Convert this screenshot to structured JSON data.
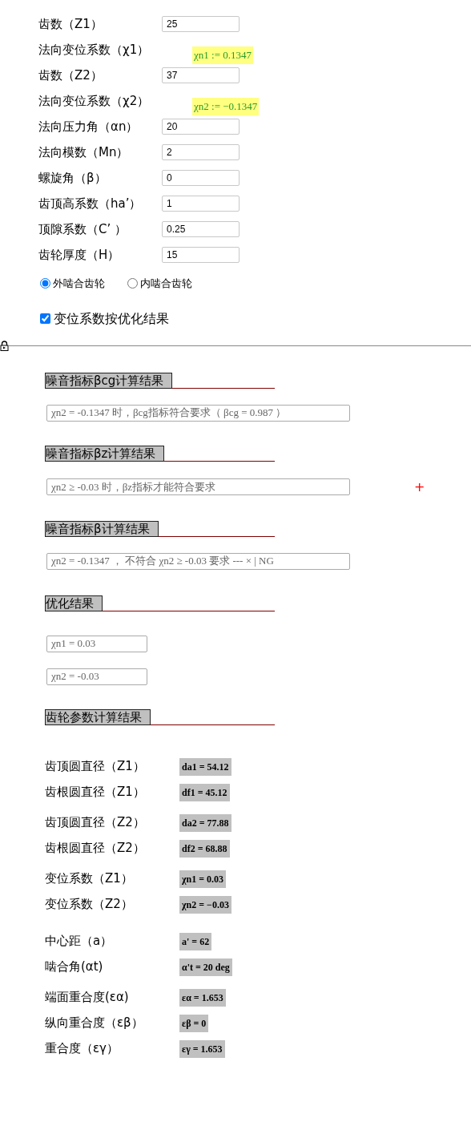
{
  "parameters": [
    {
      "kind": "input",
      "label": "齿数（Z1）",
      "value": "25"
    },
    {
      "kind": "highlight",
      "label": "法向变位系数（χ1）",
      "value": "χn1 := 0.1347"
    },
    {
      "kind": "input",
      "label": "齿数（Z2）",
      "value": "37"
    },
    {
      "kind": "highlight",
      "label": "法向变位系数（χ2）",
      "value": "χn2 := −0.1347"
    },
    {
      "kind": "input",
      "label": "法向压力角（αn）",
      "value": "20"
    },
    {
      "kind": "input",
      "label": "法向模数（Mn）",
      "value": "2"
    },
    {
      "kind": "input",
      "label": "螺旋角（β）",
      "value": "0"
    },
    {
      "kind": "input",
      "label": "齿顶高系数（ha’）",
      "value": "1"
    },
    {
      "kind": "input",
      "label": "顶隙系数（C’ ）",
      "value": "0.25"
    },
    {
      "kind": "input",
      "label": "齿轮厚度（H）",
      "value": "15"
    }
  ],
  "gear_type": [
    {
      "label": "外啮合齿轮",
      "selected": true
    },
    {
      "label": "内啮合齿轮",
      "selected": false
    }
  ],
  "use_optimized": {
    "label": "变位系数按优化结果",
    "checked": true
  },
  "sections": [
    {
      "title": "噪音指标βcg计算结果",
      "fields": [
        {
          "value": "χn2 = -0.1347 时，βcg指标符合要求（ βcg = 0.987 ）",
          "wide": true
        }
      ]
    },
    {
      "title": "噪音指标βz计算结果",
      "fields": [
        {
          "value": "χn2 ≥  -0.03 时，βz指标才能符合要求",
          "wide": true
        }
      ],
      "plus": "+"
    },
    {
      "title": "噪音指标β计算结果",
      "fields": [
        {
          "value": "χn2 =   -0.1347 ， 不符合 χn2 ≥ -0.03 要求 --- × | NG",
          "wide": true
        }
      ]
    },
    {
      "title": "优化结果",
      "fields": [
        {
          "value": "χn1 = 0.03",
          "wide": false
        },
        {
          "value": "χn2 = -0.03",
          "wide": false
        }
      ]
    },
    {
      "title": "齿轮参数计算结果"
    }
  ],
  "results": [
    [
      {
        "label": "齿顶圆直径（Z1）",
        "value": "da1 = 54.12"
      },
      {
        "label": "齿根圆直径（Z1）",
        "value": "df1 = 45.12"
      }
    ],
    [
      {
        "label": "齿顶圆直径（Z2）",
        "value": "da2 = 77.88"
      },
      {
        "label": "齿根圆直径（Z2）",
        "value": "df2 = 68.88"
      }
    ],
    [
      {
        "label": "变位系数（Z1）",
        "value": "χn1 = 0.03"
      },
      {
        "label": "变位系数（Z2）",
        "value": "χn2 = −0.03"
      }
    ],
    [
      {
        "label": "中心距（a）",
        "value": "a' = 62"
      },
      {
        "label": "啮合角(αt)",
        "value": "α't = 20 deg"
      }
    ],
    [
      {
        "label": "端面重合度(εα)",
        "value": "εα = 1.653"
      },
      {
        "label": "纵向重合度（εβ）",
        "value": "εβ = 0"
      },
      {
        "label": "重合度（εγ）",
        "value": "εγ = 1.653"
      }
    ]
  ]
}
